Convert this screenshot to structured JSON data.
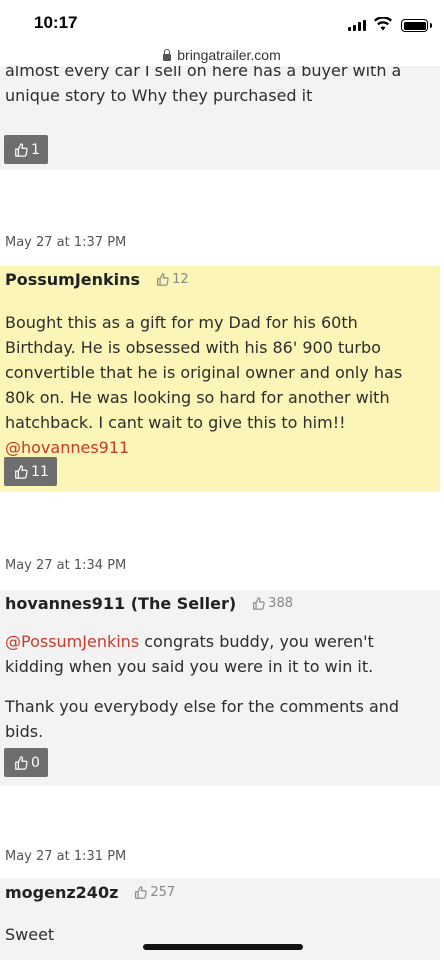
{
  "status_bar": {
    "time": "10:17"
  },
  "browser": {
    "url": "bringatrailer.com"
  },
  "comments": [
    {
      "text_partial": "almost every car I sell on here has a buyer with a unique story to Why they purchased it",
      "like_count": "1"
    },
    {
      "timestamp": "May 27 at 1:37 PM",
      "author": "PossumJenkins",
      "author_likes": "12",
      "text": "Bought this as a gift for my Dad for his 60th Birthday. He is obsessed with his 86' 900 turbo convertible that he is original owner and only has 80k on. He was looking so hard for another with hatchback. I cant wait to give this to him!! ",
      "mention": "@hovannes911",
      "like_count": "11"
    },
    {
      "timestamp": "May 27 at 1:34 PM",
      "author": "hovannes911 (The Seller)",
      "author_likes": "388",
      "mention": "@PossumJenkins",
      "text": " congrats buddy, you weren't kidding when you said you were in it to win it.",
      "text2": "Thank you everybody else for the comments and bids.",
      "like_count": "0"
    },
    {
      "timestamp": "May 27 at 1:31 PM",
      "author": "mogenz240z",
      "author_likes": "257",
      "text": "Sweet"
    }
  ]
}
